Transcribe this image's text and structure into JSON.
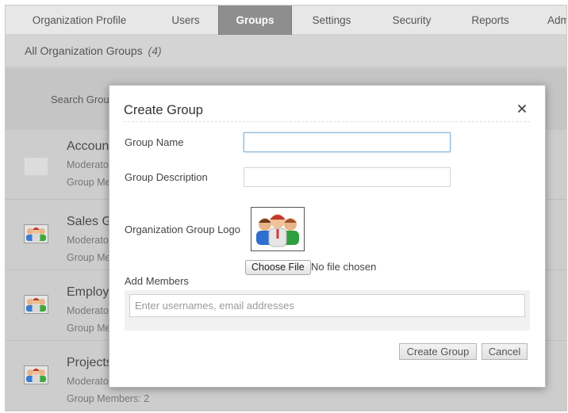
{
  "tabs": [
    {
      "label": "Organization Profile",
      "active": false
    },
    {
      "label": "Users",
      "active": false
    },
    {
      "label": "Groups",
      "active": true
    },
    {
      "label": "Settings",
      "active": false
    },
    {
      "label": "Security",
      "active": false
    },
    {
      "label": "Reports",
      "active": false
    },
    {
      "label": "Adm",
      "active": false
    }
  ],
  "header": {
    "title": "All Organization Groups",
    "count": "(4)"
  },
  "search": {
    "label": "Search Group"
  },
  "groups": [
    {
      "name": "Accoun",
      "moderator": "Moderato",
      "members": "Group Me",
      "logo": "blank"
    },
    {
      "name": "Sales G",
      "moderator": "Moderato",
      "members": "Group Me",
      "logo": "people"
    },
    {
      "name": "Employ",
      "moderator": "Moderato",
      "members": "Group Me",
      "logo": "people"
    },
    {
      "name": "Projects",
      "moderator": "Moderato",
      "members": "Group Members: 2",
      "logo": "people"
    }
  ],
  "modal": {
    "title": "Create Group",
    "close_icon": "close-icon",
    "group_name_label": "Group Name",
    "group_name_value": "",
    "group_description_label": "Group Description",
    "group_description_value": "",
    "logo_label": "Organization Group Logo",
    "choose_file_label": "Choose File",
    "no_file_text": "No file chosen",
    "add_members_label": "Add Members",
    "members_placeholder": "Enter usernames, email addresses",
    "create_button": "Create Group",
    "cancel_button": "Cancel"
  },
  "colors": {
    "active_tab": "#8e8e8e",
    "focus_border": "#8ab6d8",
    "overlay_gray": "#cdcdcd"
  }
}
